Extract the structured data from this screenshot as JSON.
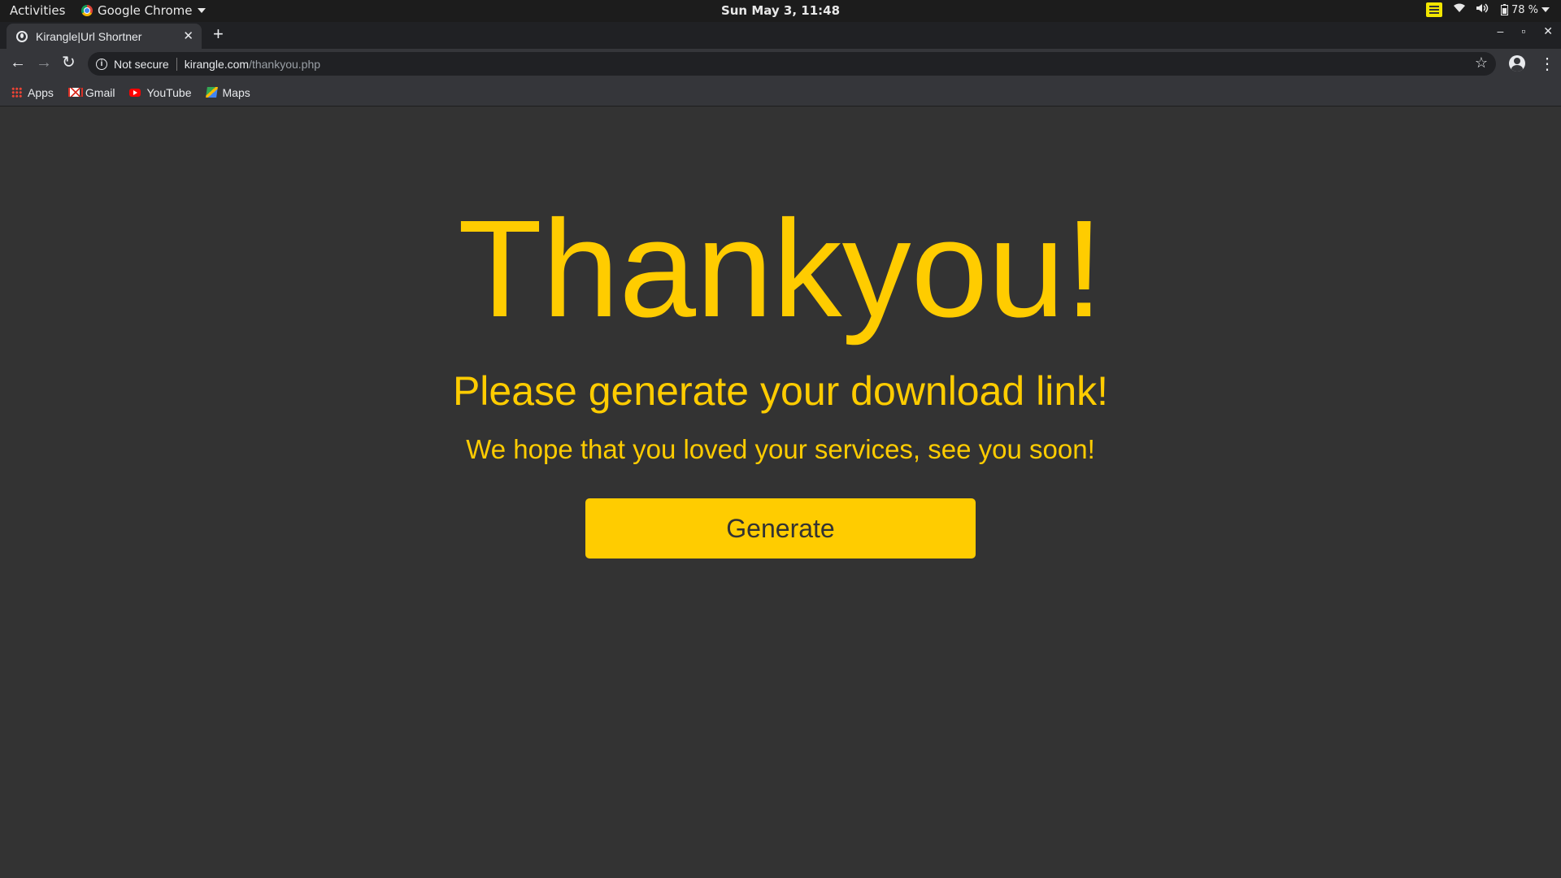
{
  "system_bar": {
    "activities": "Activities",
    "app_name": "Google Chrome",
    "clock": "Sun May  3, 11:48",
    "battery": "78 %"
  },
  "browser": {
    "tab_title": "Kirangle|Url Shortner",
    "security_label": "Not secure",
    "url_domain": "kirangle.com",
    "url_path": "/thankyou.php",
    "bookmarks": [
      {
        "label": "Apps",
        "icon": "apps-icon"
      },
      {
        "label": "Gmail",
        "icon": "gmail-icon"
      },
      {
        "label": "YouTube",
        "icon": "youtube-icon"
      },
      {
        "label": "Maps",
        "icon": "maps-icon"
      }
    ]
  },
  "page": {
    "title": "Thankyou!",
    "subtitle": "Please generate your download link!",
    "tagline": "We hope that you loved your services, see you soon!",
    "button_label": "Generate"
  },
  "colors": {
    "accent": "#ffcc00",
    "background": "#333333"
  }
}
